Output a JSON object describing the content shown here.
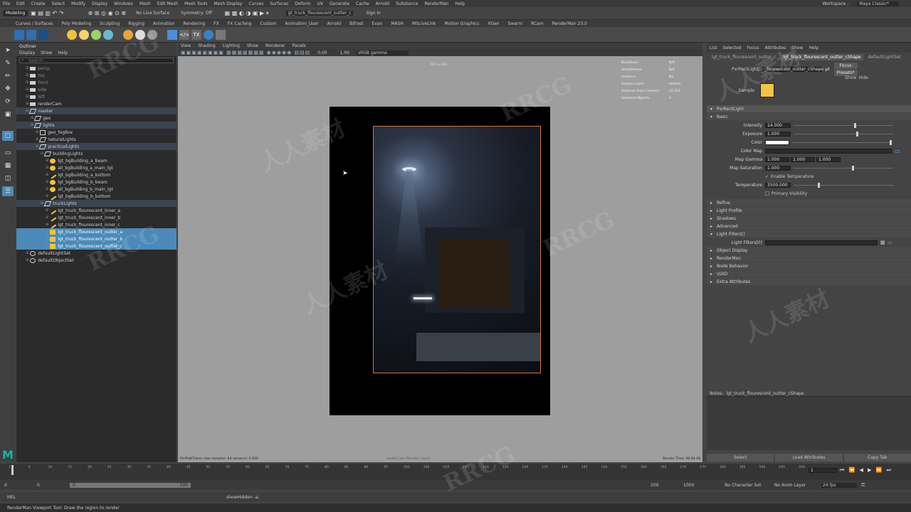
{
  "menubar": {
    "items": [
      "File",
      "Edit",
      "Create",
      "Select",
      "Modify",
      "Display",
      "Windows",
      "Mesh",
      "Edit Mesh",
      "Mesh Tools",
      "Mesh Display",
      "Curves",
      "Surfaces",
      "Deform",
      "UV",
      "Generate",
      "Cache",
      "Arnold",
      "Substance",
      "RenderMan",
      "Help"
    ],
    "workspace_label": "Workspace :",
    "workspace_value": "Maya Classic*"
  },
  "statusline": {
    "mode": "Modeling",
    "live_surface": "No Live Surface",
    "symmetry": "Symmetry: Off",
    "selected_name": "gt_truck_flourescent_outter_c",
    "sign_in": "Sign In"
  },
  "shelf_tabs": [
    "Curves / Surfaces",
    "Poly Modeling",
    "Sculpting",
    "Rigging",
    "Animation",
    "Rendering",
    "FX",
    "FX Caching",
    "Custom",
    "Animation_User",
    "Arnold",
    "Bifrost",
    "Evan",
    "MASH",
    "MSLiveLink",
    "Motion Graphics",
    "XGen",
    "Swarm",
    "RCam",
    "RenderMan 23.0"
  ],
  "outliner": {
    "title": "Outliner",
    "menu": [
      "Display",
      "Show",
      "Help"
    ],
    "search_placeholder": "Search...",
    "items": [
      {
        "label": "persp",
        "indent": 1,
        "icon": "camera",
        "dim": true
      },
      {
        "label": "top",
        "indent": 1,
        "icon": "camera",
        "dim": true
      },
      {
        "label": "front",
        "indent": 1,
        "icon": "camera",
        "dim": true
      },
      {
        "label": "side",
        "indent": 1,
        "icon": "camera",
        "dim": true
      },
      {
        "label": "left",
        "indent": 1,
        "icon": "camera",
        "dim": true
      },
      {
        "label": "renderCam",
        "indent": 1,
        "icon": "camera"
      },
      {
        "label": "master",
        "indent": 1,
        "icon": "group",
        "set": true
      },
      {
        "label": "geo",
        "indent": 2,
        "icon": "group"
      },
      {
        "label": "lights",
        "indent": 2,
        "icon": "group",
        "set": true
      },
      {
        "label": "geo_fogBox",
        "indent": 3,
        "icon": "mesh"
      },
      {
        "label": "naturalLights",
        "indent": 3,
        "icon": "group"
      },
      {
        "label": "practicalLights",
        "indent": 3,
        "icon": "group",
        "set": true
      },
      {
        "label": "buildingLights",
        "indent": 4,
        "icon": "group"
      },
      {
        "label": "lgt_bgBuilding_a_beam",
        "indent": 5,
        "icon": "light-yellow"
      },
      {
        "label": "all_bgBuilding_a_main_lgt",
        "indent": 5,
        "icon": "light-yellow"
      },
      {
        "label": "lgt_bgBuilding_a_bottom",
        "indent": 5,
        "icon": "light-line"
      },
      {
        "label": "lgt_bgBuilding_b_beam",
        "indent": 5,
        "icon": "light-yellow"
      },
      {
        "label": "all_bgBuilding_b_main_lgt",
        "indent": 5,
        "icon": "light-yellow"
      },
      {
        "label": "lgt_bgBuilding_b_bottom",
        "indent": 5,
        "icon": "light-line"
      },
      {
        "label": "truckLights",
        "indent": 4,
        "icon": "group",
        "set": true
      },
      {
        "label": "lgt_truck_flourescent_inner_a",
        "indent": 5,
        "icon": "light-line"
      },
      {
        "label": "lgt_truck_flourescent_inner_b",
        "indent": 5,
        "icon": "light-line"
      },
      {
        "label": "lgt_truck_flourescent_inner_c",
        "indent": 5,
        "icon": "light-line"
      },
      {
        "label": "lgt_truck_flourescent_outter_a",
        "indent": 5,
        "icon": "light-rect",
        "selected": true
      },
      {
        "label": "lgt_truck_flourescent_outter_b",
        "indent": 5,
        "icon": "light-rect",
        "selected": true
      },
      {
        "label": "lgt_truck_flourescent_outter_c",
        "indent": 5,
        "icon": "light-rect",
        "selected": true
      },
      {
        "label": "defaultLightSet",
        "indent": 1,
        "icon": "set"
      },
      {
        "label": "defaultObjectSet",
        "indent": 1,
        "icon": "set"
      }
    ]
  },
  "viewport": {
    "menu": [
      "View",
      "Shading",
      "Lighting",
      "Show",
      "Renderer",
      "Panels"
    ],
    "exposure": "0.00",
    "gamma": "1.00",
    "color_space": "sRGB gamma",
    "resolution": "945 x 960",
    "hud": [
      {
        "label": "Backfaces:",
        "value": "N/A"
      },
      {
        "label": "Smoothness:",
        "value": "N/A"
      },
      {
        "label": "Instance:",
        "value": "No"
      },
      {
        "label": "Display Layer:",
        "value": "default"
      },
      {
        "label": "Distance From Camera:",
        "value": "22.321"
      },
      {
        "label": "Selected Objects:",
        "value": "3"
      }
    ],
    "status_left": "PxrPathTracer  max samples: 64  variance: 0.050",
    "status_center": "renderCam (Monitor Layer)",
    "status_right": "Render Time: 00:04.48"
  },
  "attribute_editor": {
    "menu": [
      "List",
      "Selected",
      "Focus",
      "Attributes",
      "Show",
      "Help"
    ],
    "tabs": [
      "lgt_truck_flourescent_outter_c",
      "lgt_truck_flourescent_outter_cShape",
      "defaultLightSet"
    ],
    "type_label": "PxrRectLight:",
    "type_value": "_flourescent_outter_cShape",
    "focus_btn": "Focus",
    "presets_btn": "Presets*",
    "show_btn": "Show",
    "hide_btn": "Hide",
    "sample_label": "Sample",
    "sample_color": "#f4c542",
    "section_main": "PxrRectLight",
    "section_basic": "Basic",
    "intensity_label": "Intensity",
    "intensity": "14.000",
    "intensity_level": 0.62,
    "exposure_label": "Exposure",
    "exposure": "1.000",
    "exposure_level": 0.64,
    "color_label": "Color",
    "color_value": "#ffffff",
    "color_map_label": "Color Map",
    "map_gamma_label": "Map Gamma",
    "map_gamma": [
      "1.000",
      "1.000",
      "1.000"
    ],
    "map_saturation_label": "Map Saturation",
    "map_saturation": "1.000",
    "map_saturation_level": 0.6,
    "enable_temp_label": "Enable Temperature",
    "temperature_label": "Temperature",
    "temperature": "3500.000",
    "temperature_level": 0.25,
    "primary_vis_label": "Primary Visibility",
    "collapsed_sections_a": [
      "Refine",
      "Light Profile",
      "Shadows",
      "Advanced"
    ],
    "light_filters_section": "Light Filters[]",
    "light_filters_label": "Light Filters[0]",
    "collapsed_sections_b": [
      "Object Display",
      "RenderMan",
      "Node Behavior",
      "UUID",
      "Extra Attributes"
    ],
    "notes_label": "Notes:",
    "notes_value": "lgt_truck_flourescent_outter_cShape",
    "bottom_buttons": [
      "Select",
      "Load Attributes",
      "Copy Tab"
    ]
  },
  "timeline": {
    "ticks": [
      "1",
      "5",
      "10",
      "15",
      "20",
      "25",
      "30",
      "35",
      "40",
      "45",
      "50",
      "55",
      "60",
      "65",
      "70",
      "75",
      "80",
      "85",
      "90",
      "95",
      "100",
      "105",
      "110",
      "115",
      "120",
      "125",
      "130",
      "135",
      "140",
      "145",
      "150",
      "155",
      "160",
      "165",
      "170",
      "175",
      "180",
      "185",
      "190",
      "195",
      "200"
    ],
    "current_frame": "1"
  },
  "range": {
    "start": "0",
    "anim_start": "0",
    "slider_start": "0",
    "slider_end": "200",
    "range_end": "200",
    "anim_end": "1000",
    "char_set": "No Character Set",
    "anim_layer": "No Anim Layer",
    "fps": "24 fps"
  },
  "command": {
    "mode": "MEL",
    "text": "showHidden -a;"
  },
  "help_text": "RenderMan Viewport Tool: Draw the region to render",
  "watermarks": [
    "RRCG",
    "人人素材",
    "RRCG",
    "人人素材",
    "RRCG",
    "人人素材",
    "RRCG",
    "人人素材",
    "RRCG"
  ]
}
